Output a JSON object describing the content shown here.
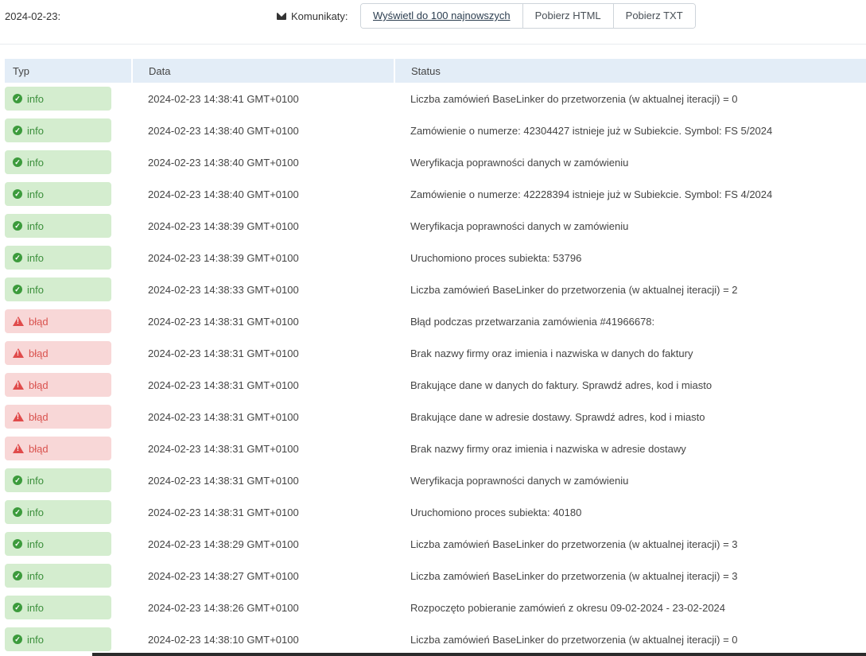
{
  "header": {
    "date": "2024-02-23:",
    "komunikaty_label": "Komunikaty:",
    "buttons": [
      {
        "label": "Wyświetl do 100 najnowszych"
      },
      {
        "label": "Pobierz HTML"
      },
      {
        "label": "Pobierz TXT"
      }
    ]
  },
  "table": {
    "columns": [
      "Typ",
      "Data",
      "Status"
    ],
    "rows": [
      {
        "type": "info",
        "label": "info",
        "date": "2024-02-23 14:38:41 GMT+0100",
        "status": "Liczba zamówień BaseLinker do przetworzenia (w aktualnej iteracji) = 0"
      },
      {
        "type": "info",
        "label": "info",
        "date": "2024-02-23 14:38:40 GMT+0100",
        "status": "Zamówienie o numerze: 42304427 istnieje już w Subiekcie. Symbol: FS 5/2024"
      },
      {
        "type": "info",
        "label": "info",
        "date": "2024-02-23 14:38:40 GMT+0100",
        "status": "Weryfikacja poprawności danych w zamówieniu"
      },
      {
        "type": "info",
        "label": "info",
        "date": "2024-02-23 14:38:40 GMT+0100",
        "status": "Zamówienie o numerze: 42228394 istnieje już w Subiekcie. Symbol: FS 4/2024"
      },
      {
        "type": "info",
        "label": "info",
        "date": "2024-02-23 14:38:39 GMT+0100",
        "status": "Weryfikacja poprawności danych w zamówieniu"
      },
      {
        "type": "info",
        "label": "info",
        "date": "2024-02-23 14:38:39 GMT+0100",
        "status": "Uruchomiono proces subiekta: 53796"
      },
      {
        "type": "info",
        "label": "info",
        "date": "2024-02-23 14:38:33 GMT+0100",
        "status": "Liczba zamówień BaseLinker do przetworzenia (w aktualnej iteracji) = 2"
      },
      {
        "type": "error",
        "label": "błąd",
        "date": "2024-02-23 14:38:31 GMT+0100",
        "status": "Błąd podczas przetwarzania zamówienia #41966678:"
      },
      {
        "type": "error",
        "label": "błąd",
        "date": "2024-02-23 14:38:31 GMT+0100",
        "status": "Brak nazwy firmy oraz imienia i nazwiska w danych do faktury"
      },
      {
        "type": "error",
        "label": "błąd",
        "date": "2024-02-23 14:38:31 GMT+0100",
        "status": "Brakujące dane w danych do faktury. Sprawdź adres, kod i miasto"
      },
      {
        "type": "error",
        "label": "błąd",
        "date": "2024-02-23 14:38:31 GMT+0100",
        "status": "Brakujące dane w adresie dostawy. Sprawdź adres, kod i miasto"
      },
      {
        "type": "error",
        "label": "błąd",
        "date": "2024-02-23 14:38:31 GMT+0100",
        "status": "Brak nazwy firmy oraz imienia i nazwiska w adresie dostawy"
      },
      {
        "type": "info",
        "label": "info",
        "date": "2024-02-23 14:38:31 GMT+0100",
        "status": "Weryfikacja poprawności danych w zamówieniu"
      },
      {
        "type": "info",
        "label": "info",
        "date": "2024-02-23 14:38:31 GMT+0100",
        "status": "Uruchomiono proces subiekta: 40180"
      },
      {
        "type": "info",
        "label": "info",
        "date": "2024-02-23 14:38:29 GMT+0100",
        "status": "Liczba zamówień BaseLinker do przetworzenia (w aktualnej iteracji) = 3"
      },
      {
        "type": "info",
        "label": "info",
        "date": "2024-02-23 14:38:27 GMT+0100",
        "status": "Liczba zamówień BaseLinker do przetworzenia (w aktualnej iteracji) = 3"
      },
      {
        "type": "info",
        "label": "info",
        "date": "2024-02-23 14:38:26 GMT+0100",
        "status": "Rozpoczęto pobieranie zamówień z okresu 09-02-2024 - 23-02-2024"
      },
      {
        "type": "info",
        "label": "info",
        "date": "2024-02-23 14:38:10 GMT+0100",
        "status": "Liczba zamówień BaseLinker do przetworzenia (w aktualnej iteracji) = 0"
      }
    ]
  },
  "colors": {
    "info_bg": "#d4edcf",
    "info_text": "#3c8f3c",
    "error_bg": "#f8d7d7",
    "error_text": "#d9534f",
    "header_bg": "#e3edf7"
  },
  "icons": {
    "info": "check-circle-icon",
    "error": "warning-triangle-icon",
    "komunikaty": "envelope-icon"
  }
}
